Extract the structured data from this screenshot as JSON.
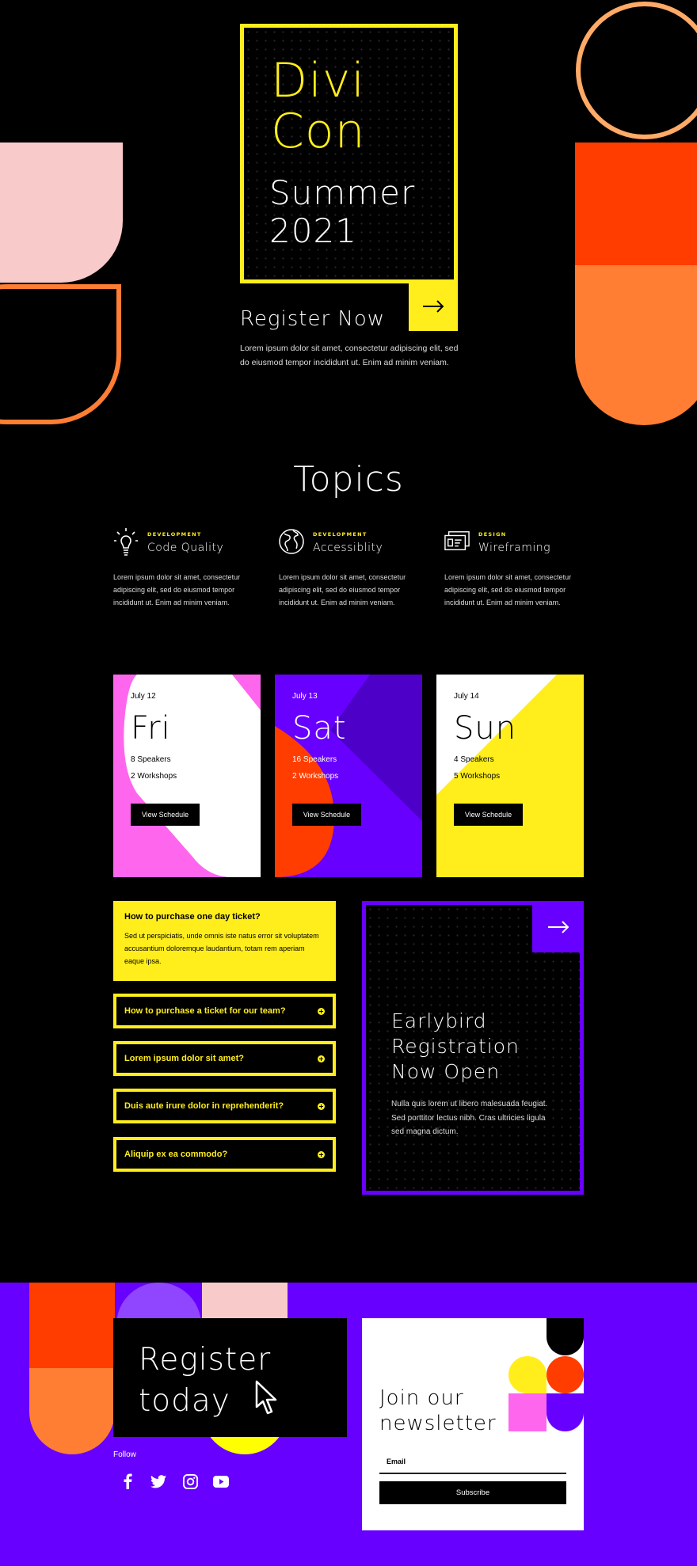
{
  "colors": {
    "background": "#000000",
    "yellow": "#ffee1c",
    "purple": "#6800ff",
    "red": "#ff3d00",
    "orange": "#ff7e33",
    "pink": "#f8cbca",
    "magenta": "#ff66ee"
  },
  "hero": {
    "title_line1": "Divi",
    "title_line2": "Con",
    "subtitle_line1": "Summer",
    "subtitle_line2": "2021",
    "cta_label": "Register Now",
    "arrow_icon": "arrow-right-icon",
    "description": "Lorem ipsum dolor sit amet, consectetur adipiscing elit, sed do eiusmod tempor incididunt ut. Enim ad minim veniam."
  },
  "topics": {
    "title": "Topics",
    "items": [
      {
        "icon": "lightbulb-icon",
        "category": "DEVELOPMENT",
        "name": "Code Quality",
        "description": "Lorem ipsum dolor sit amet, consectetur adipiscing elit, sed do eiusmod tempor incididunt ut. Enim ad minim veniam."
      },
      {
        "icon": "globe-icon",
        "category": "DEVELOPMENT",
        "name": "Accessiblity",
        "description": "Lorem ipsum dolor sit amet, consectetur adipiscing elit, sed do eiusmod tempor incididunt ut. Enim ad minim veniam."
      },
      {
        "icon": "wireframe-windows-icon",
        "category": "DESIGN",
        "name": "Wireframing",
        "description": "Lorem ipsum dolor sit amet, consectetur adipiscing elit, sed do eiusmod tempor incididunt ut. Enim ad minim veniam."
      }
    ]
  },
  "schedule": {
    "days": [
      {
        "date": "July 12",
        "day": "Fri",
        "speakers": "8 Speakers",
        "workshops": "2 Workshops",
        "button": "View Schedule"
      },
      {
        "date": "July 13",
        "day": "Sat",
        "speakers": "16 Speakers",
        "workshops": "2 Workshops",
        "button": "View Schedule"
      },
      {
        "date": "July 14",
        "day": "Sun",
        "speakers": "4 Speakers",
        "workshops": "5 Workshops",
        "button": "View Schedule"
      }
    ]
  },
  "faq": {
    "open_item": {
      "question": "How to purchase one day ticket?",
      "answer": "Sed ut perspiciatis, unde omnis iste natus error sit voluptatem accusantium doloremque laudantium, totam rem aperiam eaque ipsa."
    },
    "items": [
      {
        "question": "How to purchase a ticket for our team?"
      },
      {
        "question": "Lorem ipsum dolor sit amet?"
      },
      {
        "question": "Duis aute irure dolor in reprehenderit?"
      },
      {
        "question": "Aliquip ex ea commodo?"
      }
    ]
  },
  "earlybird": {
    "title_line1": "Earlybird",
    "title_line2": "Registration",
    "title_line3": "Now Open",
    "description": "Nulla quis lorem ut libero malesuada feugiat. Sed porttitor lectus nibh. Cras ultricies ligula sed magna dictum."
  },
  "footer": {
    "register_line1": "Register",
    "register_line2": "today",
    "follow_label": "Follow",
    "social": [
      "facebook-icon",
      "twitter-icon",
      "instagram-icon",
      "youtube-icon"
    ],
    "newsletter": {
      "title_line1": "Join our",
      "title_line2": "newsletter",
      "email_placeholder": "Email",
      "subscribe_label": "Subscribe"
    }
  }
}
